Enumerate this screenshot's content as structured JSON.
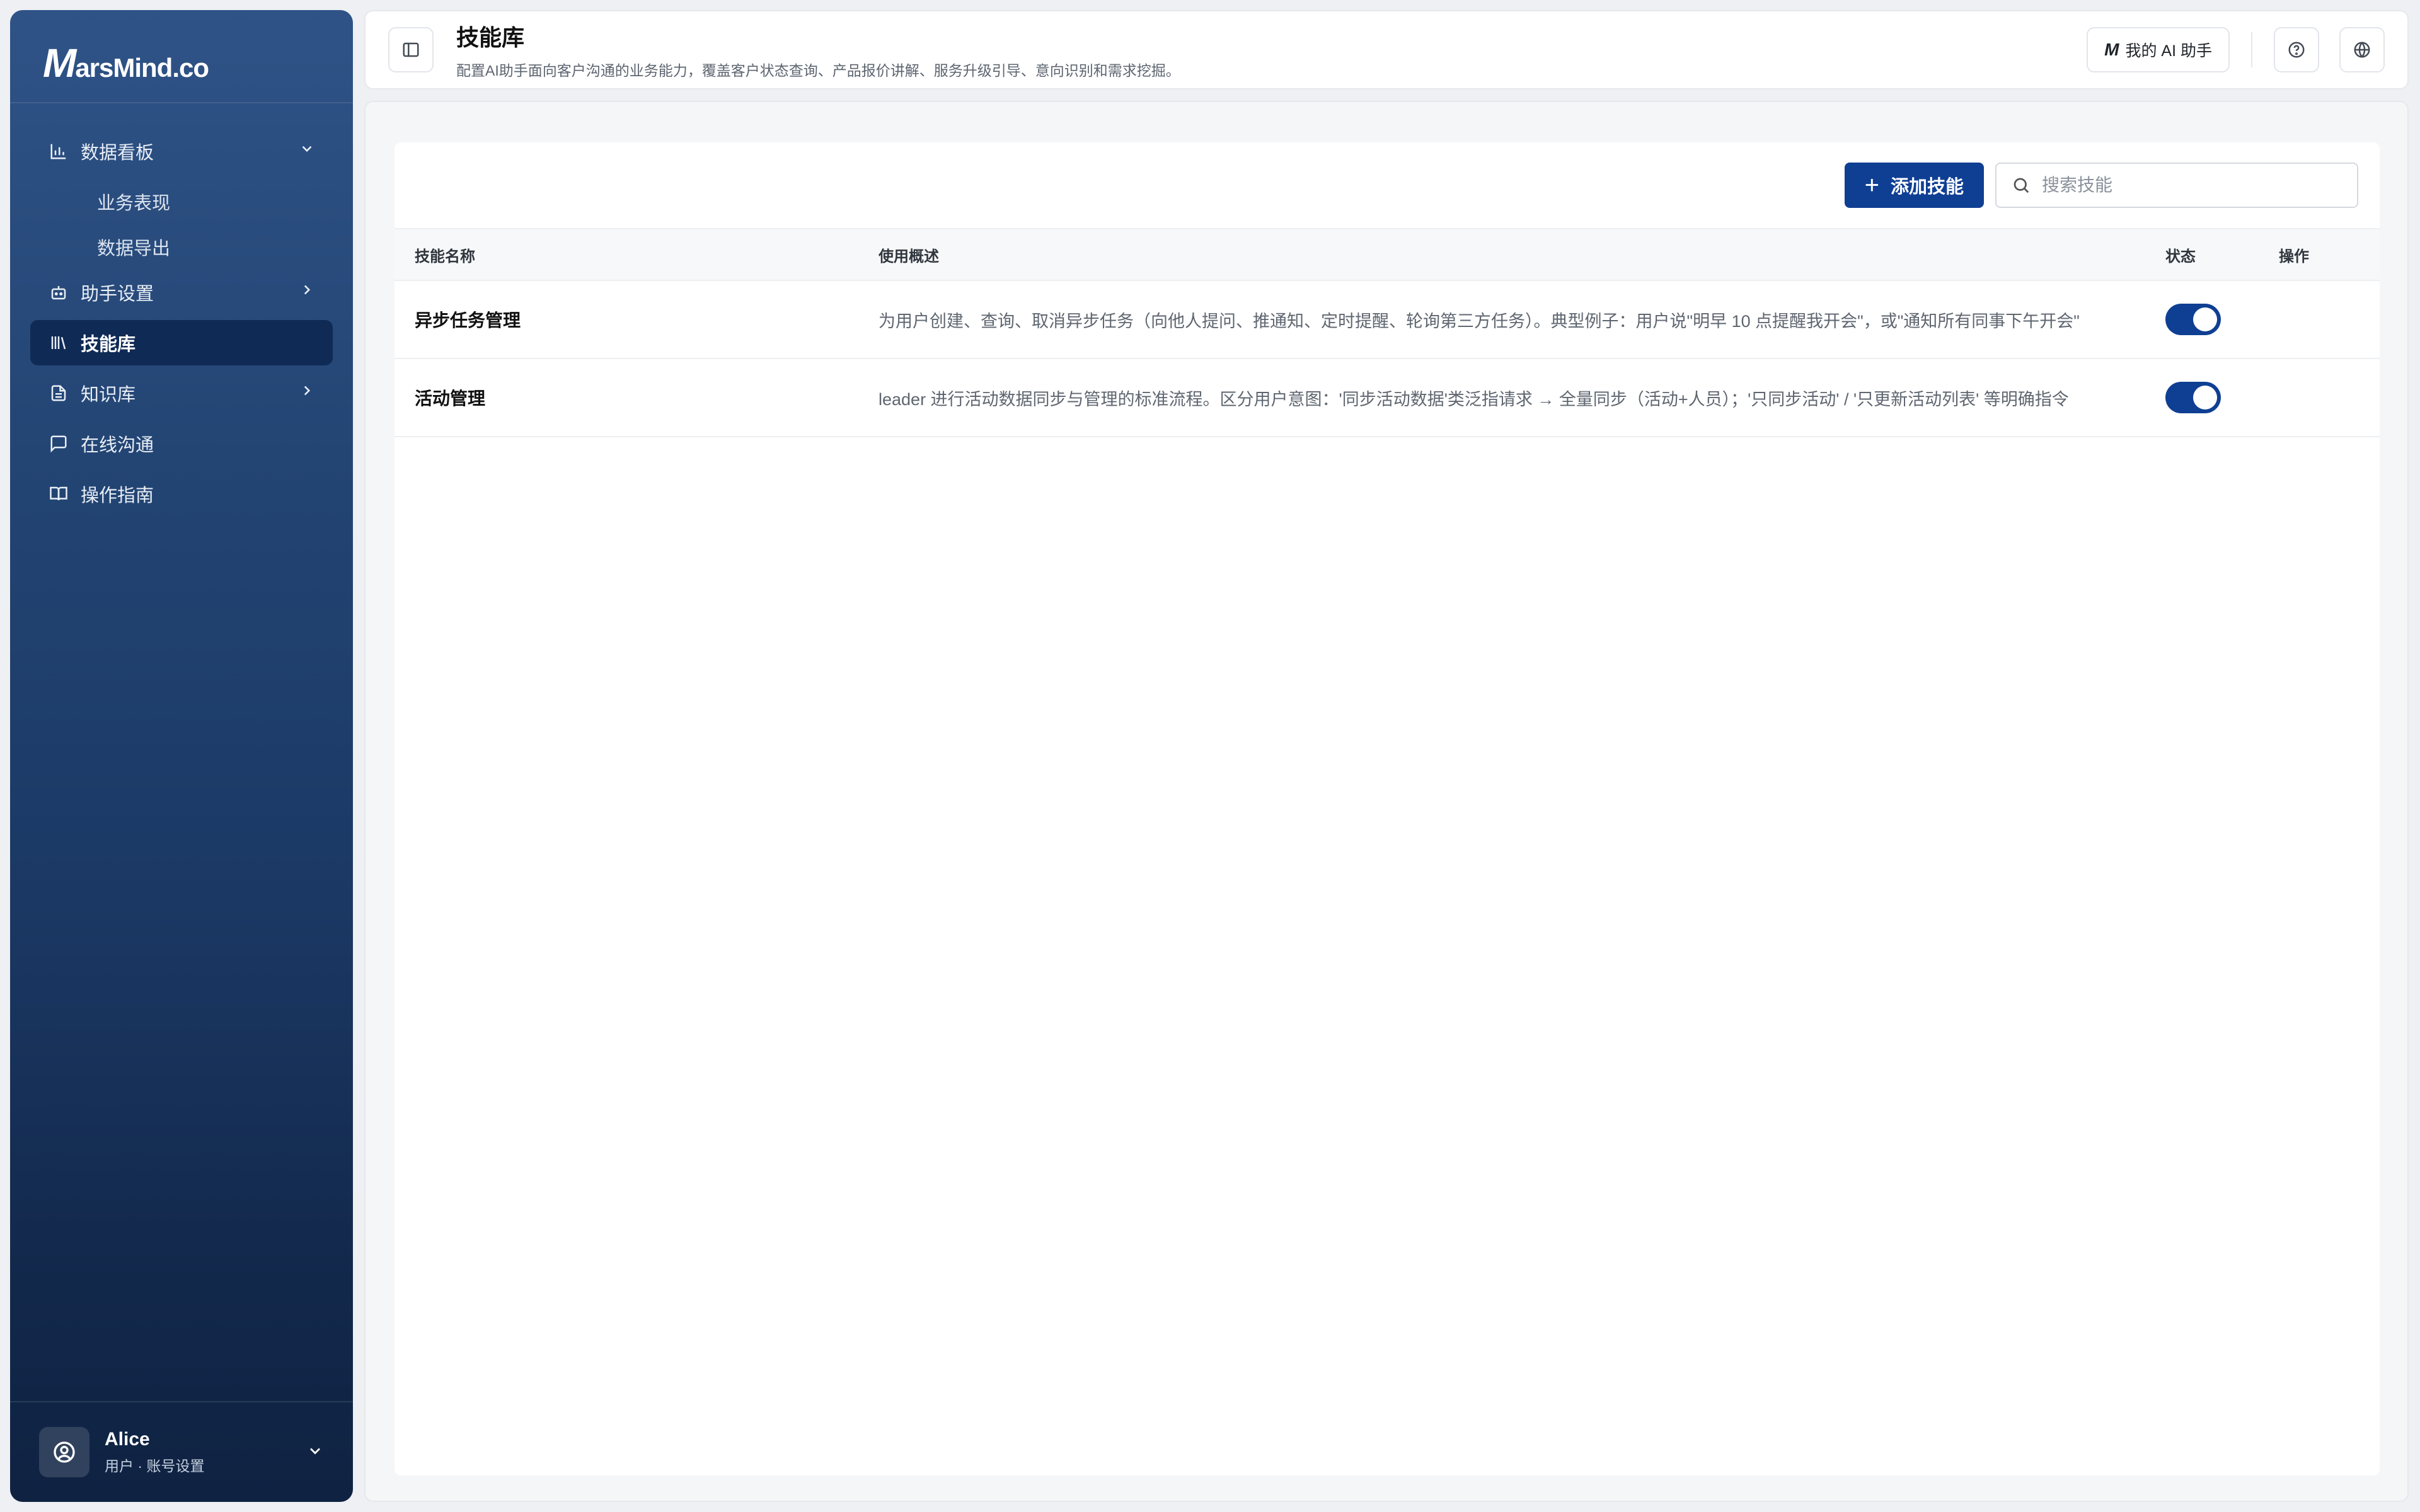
{
  "brand": {
    "logo_mark": "M",
    "logo_word": "arsMind.co"
  },
  "sidebar": {
    "items": [
      {
        "label": "数据看板"
      },
      {
        "label": "业务表现"
      },
      {
        "label": "数据导出"
      },
      {
        "label": "助手设置"
      },
      {
        "label": "技能库"
      },
      {
        "label": "知识库"
      },
      {
        "label": "在线沟通"
      },
      {
        "label": "操作指南"
      }
    ],
    "user": {
      "name": "Alice",
      "role": "用户 · 账号设置"
    }
  },
  "header": {
    "title": "技能库",
    "subtitle": "配置AI助手面向客户沟通的业务能力，覆盖客户状态查询、产品报价讲解、服务升级引导、意向识别和需求挖掘。",
    "ai_button_mark": "M",
    "ai_button_label": "我的 AI 助手"
  },
  "toolbar": {
    "add_label": "添加技能",
    "search_placeholder": "搜索技能"
  },
  "table": {
    "columns": [
      "技能名称",
      "使用概述",
      "状态",
      "操作"
    ],
    "rows": [
      {
        "name": "异步任务管理",
        "desc": "为用户创建、查询、取消异步任务（向他人提问、推通知、定时提醒、轮询第三方任务）。典型例子：用户说\"明早 10 点提醒我开会\"，或\"通知所有同事下午开会\"",
        "enabled": true
      },
      {
        "name": "活动管理",
        "desc": "leader 进行活动数据同步与管理的标准流程。区分用户意图：'同步活动数据'类泛指请求 → 全量同步（活动+人员）；'只同步活动' / '只更新活动列表' 等明确指令",
        "enabled": true
      }
    ]
  },
  "colors": {
    "accent": "#0f3f93",
    "sidebar_top": "#2f5387",
    "sidebar_bottom": "#0f2242"
  }
}
